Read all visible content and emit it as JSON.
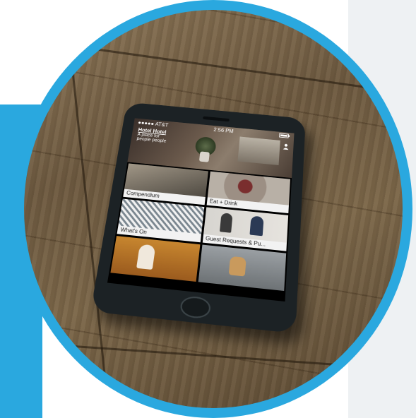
{
  "colors": {
    "accent_blue": "#2aa8df",
    "panel_gray": "#eef1f3",
    "phone_body": "#1c2225"
  },
  "status_bar": {
    "carrier": "●●●●● AT&T",
    "time": "2:56 PM",
    "battery_icon": "battery-icon"
  },
  "app": {
    "title": "Hotel Hotel",
    "tagline": "A place for people people",
    "profile_icon": "profile-icon"
  },
  "tiles": [
    {
      "label": "Compendium"
    },
    {
      "label": "Eat + Drink"
    },
    {
      "label": "What's On"
    },
    {
      "label": "Guest Requests & Pu..."
    },
    {
      "label": ""
    },
    {
      "label": ""
    }
  ]
}
